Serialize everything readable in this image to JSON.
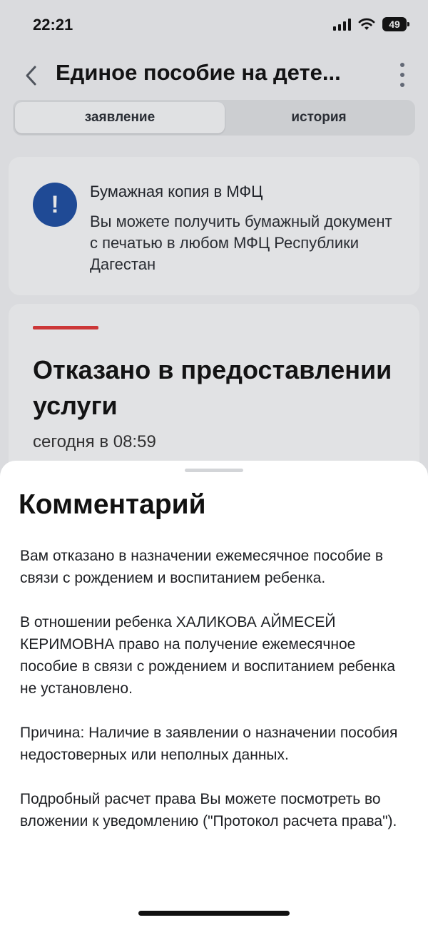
{
  "status_bar": {
    "time": "22:21",
    "battery": "49"
  },
  "header": {
    "title": "Единое пособие на дете...",
    "back_icon": "chevron-left-icon",
    "menu_icon": "more-vertical-icon"
  },
  "tabs": [
    {
      "label": "заявление",
      "active": true
    },
    {
      "label": "история",
      "active": false
    }
  ],
  "info_card": {
    "icon": "exclamation-icon",
    "title": "Бумажная копия в МФЦ",
    "text": "Вы можете получить бумажный документ с печатью в любом МФЦ Республики Дагестан"
  },
  "status_card": {
    "title": "Отказано в предоставлении услуги",
    "date": "сегодня в 08:59",
    "accent_color": "#e33a3a"
  },
  "comment_sheet": {
    "title": "Комментарий",
    "paragraphs": [
      "Вам отказано в назначении ежемесячное пособие в связи с рождением и воспитанием ребенка.",
      "В отношении ребенка ХАЛИКОВА АЙМЕСЕЙ КЕРИМОВНА право на получение ежемесячное пособие в связи с рождением и воспитанием ребенка не установлено.",
      "Причина: Наличие в заявлении о назначении пособия недостоверных или неполных данных.",
      "Подробный расчет права Вы можете посмотреть во вложении к уведомлению (\"Протокол расчета права\")."
    ]
  },
  "colors": {
    "info_icon_bg": "#1e4fa3",
    "background": "#f3f4f6"
  }
}
